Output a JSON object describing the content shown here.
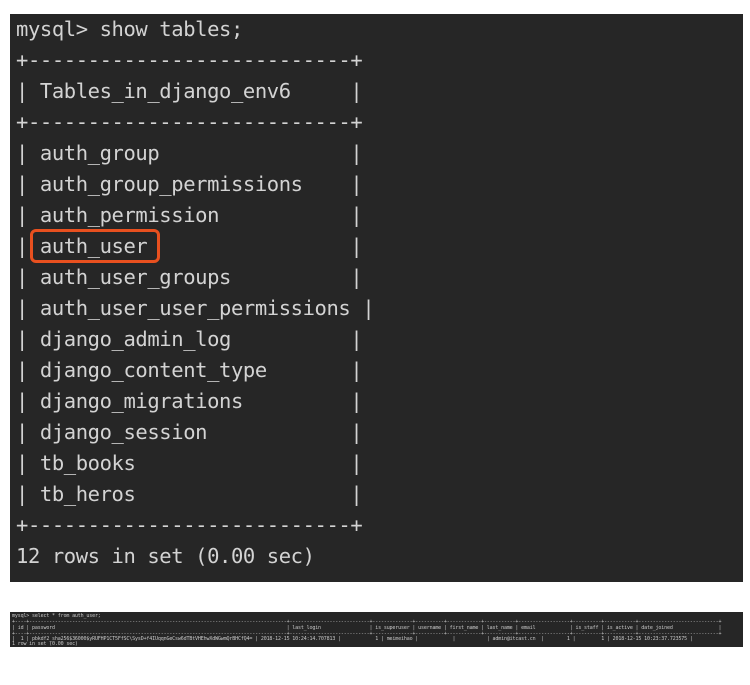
{
  "terminal_top": {
    "prompt": "mysql> show tables;",
    "border": "+---------------------------+",
    "header": "| Tables_in_django_env6     |",
    "rows": [
      "| auth_group                |",
      "| auth_group_permissions    |",
      "| auth_permission           |",
      "| auth_user                 |",
      "| auth_user_groups          |",
      "| auth_user_user_permissions |",
      "| django_admin_log          |",
      "| django_content_type       |",
      "| django_migrations         |",
      "| django_session            |",
      "| tb_books                  |",
      "| tb_heros                  |"
    ],
    "footer": "12 rows in set (0.00 sec)",
    "highlighted_row": "auth_user",
    "highlight_color": "#e8501f"
  },
  "terminal_bottom": {
    "prompt": "mysql> select * from auth_user;",
    "border": "+----+------------------------------------------------------------------------------------------+----------------------------+--------------+----------+------------+-----------+------------------+----------+-----------+----------------------------+",
    "header": "| id | password                                                                                 | last_login                 | is_superuser | username | first_name | last_name | email            | is_staff | is_active | date_joined                |",
    "row": "|  1 | pbkdf2_sha256$36000$yRUFHP1CT5FfSC\\SysD+f4IUqqnGeCsw6dTBtVHEhwXdWGwmQrBHCfQ4= | 2018-12-15 10:24:14.707813 |            1 | meimeihao |            |           | admin@itcast.cn  |        1 |         1 | 2018-12-15 10:23:37.723575 |",
    "footer": "1 row in set (0.00 sec)"
  }
}
